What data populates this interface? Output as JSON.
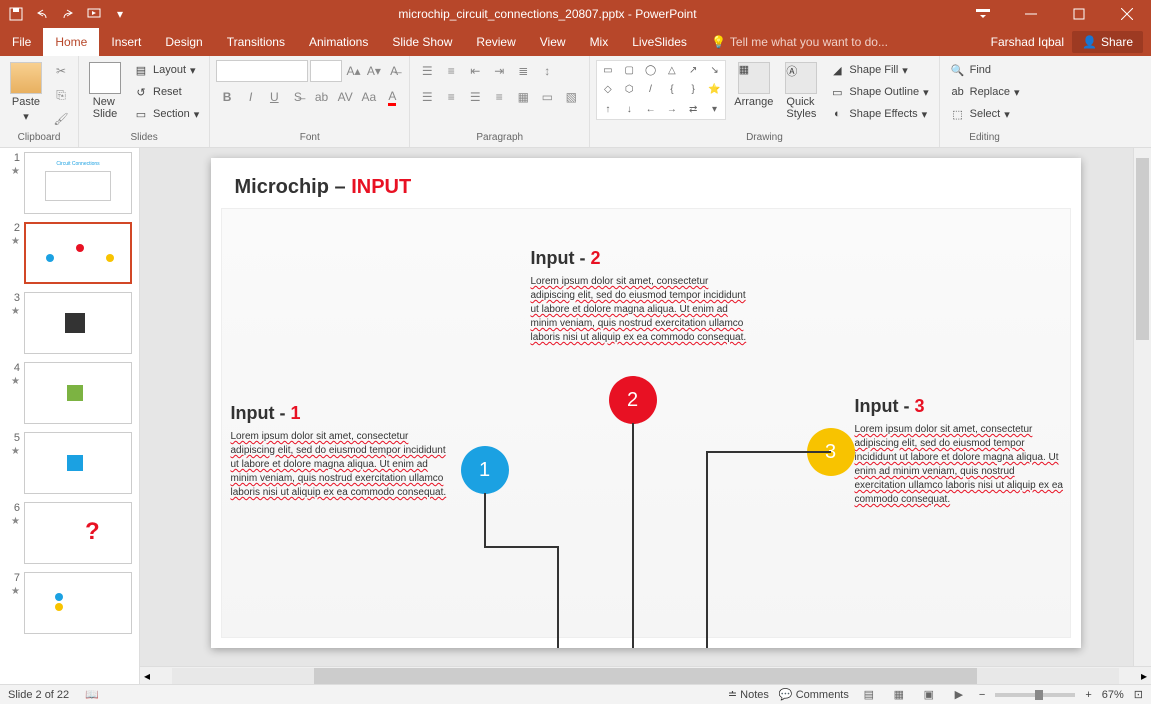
{
  "title": "microchip_circuit_connections_20807.pptx - PowerPoint",
  "menu": {
    "file": "File",
    "home": "Home",
    "insert": "Insert",
    "design": "Design",
    "transitions": "Transitions",
    "animations": "Animations",
    "slideshow": "Slide Show",
    "review": "Review",
    "view": "View",
    "mix": "Mix",
    "liveslides": "LiveSlides"
  },
  "tellme": "Tell me what you want to do...",
  "user": "Farshad Iqbal",
  "share": "Share",
  "ribbon": {
    "clipboard": {
      "label": "Clipboard",
      "paste": "Paste"
    },
    "slides": {
      "label": "Slides",
      "new": "New\nSlide",
      "layout": "Layout",
      "reset": "Reset",
      "section": "Section"
    },
    "font": {
      "label": "Font"
    },
    "paragraph": {
      "label": "Paragraph"
    },
    "drawing": {
      "label": "Drawing",
      "arrange": "Arrange",
      "quick": "Quick\nStyles",
      "fill": "Shape Fill",
      "outline": "Shape Outline",
      "effects": "Shape Effects"
    },
    "editing": {
      "label": "Editing",
      "find": "Find",
      "replace": "Replace",
      "select": "Select"
    }
  },
  "thumbs": [
    "1",
    "2",
    "3",
    "4",
    "5",
    "6",
    "7"
  ],
  "slide": {
    "title_a": "Microchip – ",
    "title_b": "INPUT",
    "inputs": [
      {
        "heading": "Input - ",
        "num": "1",
        "body": "Lorem ipsum dolor sit amet, consectetur adipiscing elit, sed do eiusmod tempor incididunt ut labore et dolore magna aliqua. Ut enim ad minim veniam, quis nostrud exercitation ullamco laboris nisi ut aliquip ex ea commodo consequat."
      },
      {
        "heading": "Input - ",
        "num": "2",
        "body": "Lorem ipsum dolor sit amet, consectetur adipiscing elit, sed do eiusmod tempor incididunt ut labore et dolore magna aliqua. Ut enim ad minim veniam, quis nostrud exercitation ullamco laboris nisi ut aliquip ex ea commodo consequat."
      },
      {
        "heading": "Input - ",
        "num": "3",
        "body": "Lorem ipsum dolor sit amet, consectetur adipiscing elit, sed do eiusmod tempor incididunt ut labore et dolore magna aliqua. Ut enim ad minim veniam, quis nostrud exercitation ullamco laboris nisi ut aliquip ex ea commodo consequat."
      }
    ]
  },
  "status": {
    "slide": "Slide 2 of 22",
    "notes": "Notes",
    "comments": "Comments",
    "zoom": "67%"
  }
}
